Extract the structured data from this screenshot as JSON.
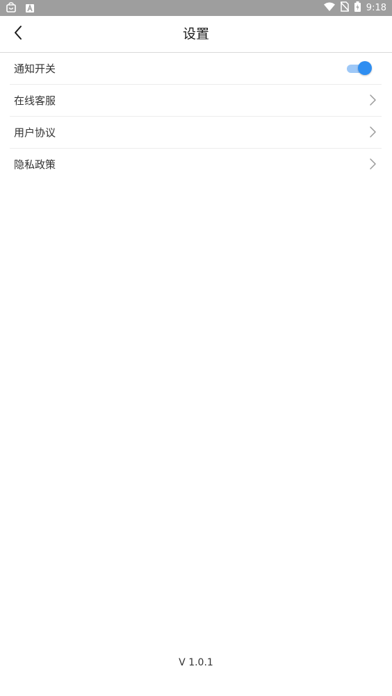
{
  "status_bar": {
    "time": "9:18",
    "icons": [
      "shopping-bag-icon",
      "keyboard-a-icon",
      "wifi-icon",
      "no-sim-icon",
      "battery-charging-icon"
    ]
  },
  "app_bar": {
    "title": "设置",
    "back_icon": "chevron-left-icon"
  },
  "settings": {
    "items": [
      {
        "label": "通知开关",
        "control": "toggle",
        "enabled": true
      },
      {
        "label": "在线客服",
        "control": "chevron"
      },
      {
        "label": "用户协议",
        "control": "chevron"
      },
      {
        "label": "隐私政策",
        "control": "chevron"
      }
    ]
  },
  "footer": {
    "version": "V 1.0.1"
  },
  "colors": {
    "status_bar_bg": "#9e9e9e",
    "toggle_thumb": "#2f8ef1",
    "toggle_track": "#9ec8f7",
    "divider": "#ececec",
    "text": "#333333"
  }
}
